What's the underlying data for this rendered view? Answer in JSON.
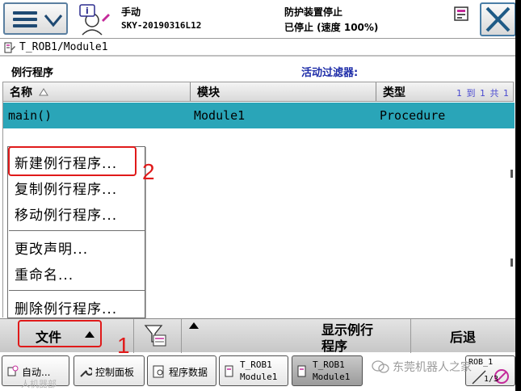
{
  "status": {
    "mode": "手动",
    "controller": "SKY-20190316L12",
    "state": "防护装置停止",
    "speed_state": "已停止 (速度 100%)"
  },
  "path": "T_ROB1/Module1",
  "section": {
    "title": "例行程序",
    "filter_label": "活动过滤器:"
  },
  "table": {
    "headers": [
      "名称",
      "模块",
      "类型"
    ],
    "page_count": "1 到 1 共 1",
    "rows": [
      {
        "name": "main()",
        "module": "Module1",
        "type": "Procedure"
      }
    ]
  },
  "popup_menu": {
    "items": [
      "新建例行程序...",
      "复制例行程序...",
      "移动例行程序...",
      "更改声明...",
      "重命名...",
      "删除例行程序..."
    ]
  },
  "command_bar": {
    "file": "文件",
    "show_routine_line1": "显示例行",
    "show_routine_line2": "程序",
    "back": "后退"
  },
  "taskbar": {
    "auto": "自动...",
    "control_panel": "控制面板",
    "program_data": "程序数据",
    "task1_line1": "T_ROB1",
    "task1_line2": "Module1",
    "task2_line1": "T_ROB1",
    "task2_line2": "Module1",
    "rob_label": "ROB_1",
    "rob_fraction": "1/3"
  },
  "annotations": {
    "n1": "1",
    "n2": "2"
  },
  "watermark": "东莞机器人之家",
  "watermark_sub": "人机器部",
  "colors": {
    "selection": "#2aa5b8",
    "annotation": "#e01a1a",
    "filter": "#1d2ca8"
  }
}
